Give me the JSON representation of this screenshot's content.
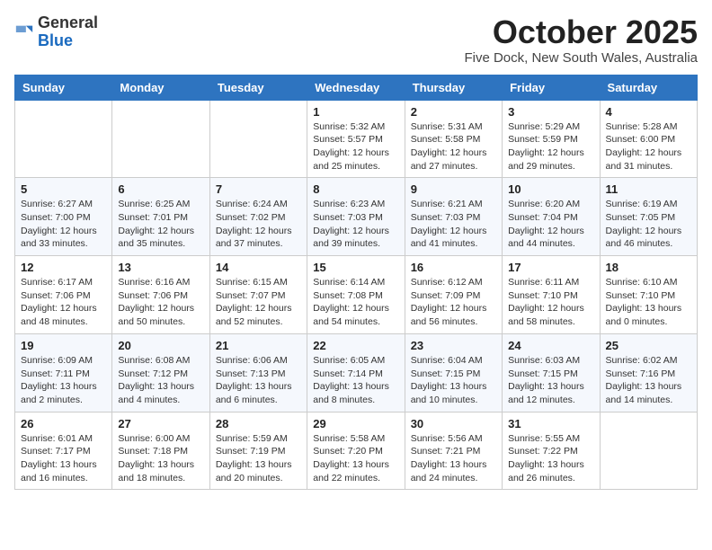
{
  "logo": {
    "general": "General",
    "blue": "Blue"
  },
  "header": {
    "month": "October 2025",
    "location": "Five Dock, New South Wales, Australia"
  },
  "weekdays": [
    "Sunday",
    "Monday",
    "Tuesday",
    "Wednesday",
    "Thursday",
    "Friday",
    "Saturday"
  ],
  "weeks": [
    [
      {
        "day": "",
        "detail": ""
      },
      {
        "day": "",
        "detail": ""
      },
      {
        "day": "",
        "detail": ""
      },
      {
        "day": "1",
        "detail": "Sunrise: 5:32 AM\nSunset: 5:57 PM\nDaylight: 12 hours\nand 25 minutes."
      },
      {
        "day": "2",
        "detail": "Sunrise: 5:31 AM\nSunset: 5:58 PM\nDaylight: 12 hours\nand 27 minutes."
      },
      {
        "day": "3",
        "detail": "Sunrise: 5:29 AM\nSunset: 5:59 PM\nDaylight: 12 hours\nand 29 minutes."
      },
      {
        "day": "4",
        "detail": "Sunrise: 5:28 AM\nSunset: 6:00 PM\nDaylight: 12 hours\nand 31 minutes."
      }
    ],
    [
      {
        "day": "5",
        "detail": "Sunrise: 6:27 AM\nSunset: 7:00 PM\nDaylight: 12 hours\nand 33 minutes."
      },
      {
        "day": "6",
        "detail": "Sunrise: 6:25 AM\nSunset: 7:01 PM\nDaylight: 12 hours\nand 35 minutes."
      },
      {
        "day": "7",
        "detail": "Sunrise: 6:24 AM\nSunset: 7:02 PM\nDaylight: 12 hours\nand 37 minutes."
      },
      {
        "day": "8",
        "detail": "Sunrise: 6:23 AM\nSunset: 7:03 PM\nDaylight: 12 hours\nand 39 minutes."
      },
      {
        "day": "9",
        "detail": "Sunrise: 6:21 AM\nSunset: 7:03 PM\nDaylight: 12 hours\nand 41 minutes."
      },
      {
        "day": "10",
        "detail": "Sunrise: 6:20 AM\nSunset: 7:04 PM\nDaylight: 12 hours\nand 44 minutes."
      },
      {
        "day": "11",
        "detail": "Sunrise: 6:19 AM\nSunset: 7:05 PM\nDaylight: 12 hours\nand 46 minutes."
      }
    ],
    [
      {
        "day": "12",
        "detail": "Sunrise: 6:17 AM\nSunset: 7:06 PM\nDaylight: 12 hours\nand 48 minutes."
      },
      {
        "day": "13",
        "detail": "Sunrise: 6:16 AM\nSunset: 7:06 PM\nDaylight: 12 hours\nand 50 minutes."
      },
      {
        "day": "14",
        "detail": "Sunrise: 6:15 AM\nSunset: 7:07 PM\nDaylight: 12 hours\nand 52 minutes."
      },
      {
        "day": "15",
        "detail": "Sunrise: 6:14 AM\nSunset: 7:08 PM\nDaylight: 12 hours\nand 54 minutes."
      },
      {
        "day": "16",
        "detail": "Sunrise: 6:12 AM\nSunset: 7:09 PM\nDaylight: 12 hours\nand 56 minutes."
      },
      {
        "day": "17",
        "detail": "Sunrise: 6:11 AM\nSunset: 7:10 PM\nDaylight: 12 hours\nand 58 minutes."
      },
      {
        "day": "18",
        "detail": "Sunrise: 6:10 AM\nSunset: 7:10 PM\nDaylight: 13 hours\nand 0 minutes."
      }
    ],
    [
      {
        "day": "19",
        "detail": "Sunrise: 6:09 AM\nSunset: 7:11 PM\nDaylight: 13 hours\nand 2 minutes."
      },
      {
        "day": "20",
        "detail": "Sunrise: 6:08 AM\nSunset: 7:12 PM\nDaylight: 13 hours\nand 4 minutes."
      },
      {
        "day": "21",
        "detail": "Sunrise: 6:06 AM\nSunset: 7:13 PM\nDaylight: 13 hours\nand 6 minutes."
      },
      {
        "day": "22",
        "detail": "Sunrise: 6:05 AM\nSunset: 7:14 PM\nDaylight: 13 hours\nand 8 minutes."
      },
      {
        "day": "23",
        "detail": "Sunrise: 6:04 AM\nSunset: 7:15 PM\nDaylight: 13 hours\nand 10 minutes."
      },
      {
        "day": "24",
        "detail": "Sunrise: 6:03 AM\nSunset: 7:15 PM\nDaylight: 13 hours\nand 12 minutes."
      },
      {
        "day": "25",
        "detail": "Sunrise: 6:02 AM\nSunset: 7:16 PM\nDaylight: 13 hours\nand 14 minutes."
      }
    ],
    [
      {
        "day": "26",
        "detail": "Sunrise: 6:01 AM\nSunset: 7:17 PM\nDaylight: 13 hours\nand 16 minutes."
      },
      {
        "day": "27",
        "detail": "Sunrise: 6:00 AM\nSunset: 7:18 PM\nDaylight: 13 hours\nand 18 minutes."
      },
      {
        "day": "28",
        "detail": "Sunrise: 5:59 AM\nSunset: 7:19 PM\nDaylight: 13 hours\nand 20 minutes."
      },
      {
        "day": "29",
        "detail": "Sunrise: 5:58 AM\nSunset: 7:20 PM\nDaylight: 13 hours\nand 22 minutes."
      },
      {
        "day": "30",
        "detail": "Sunrise: 5:56 AM\nSunset: 7:21 PM\nDaylight: 13 hours\nand 24 minutes."
      },
      {
        "day": "31",
        "detail": "Sunrise: 5:55 AM\nSunset: 7:22 PM\nDaylight: 13 hours\nand 26 minutes."
      },
      {
        "day": "",
        "detail": ""
      }
    ]
  ]
}
